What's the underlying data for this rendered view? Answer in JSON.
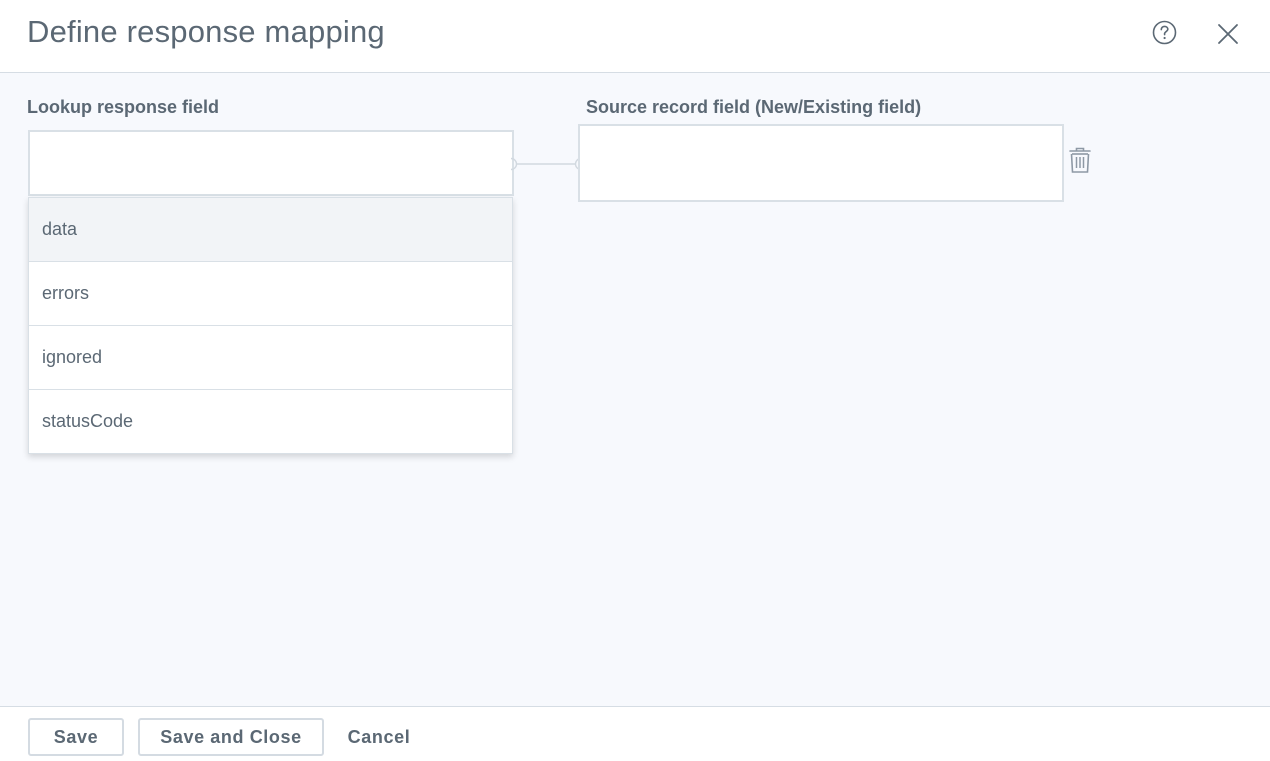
{
  "dialog": {
    "title": "Define response mapping"
  },
  "columns": {
    "lookup_label": "Lookup response field",
    "source_label": "Source record field (New/Existing field)"
  },
  "lookup_field": {
    "value": "",
    "placeholder": ""
  },
  "source_field": {
    "value": "",
    "placeholder": ""
  },
  "dropdown": {
    "options": [
      {
        "label": "data",
        "highlighted": true
      },
      {
        "label": "errors",
        "highlighted": false
      },
      {
        "label": "ignored",
        "highlighted": false
      },
      {
        "label": "statusCode",
        "highlighted": false
      }
    ]
  },
  "footer": {
    "save_label": "Save",
    "save_close_label": "Save and Close",
    "cancel_label": "Cancel"
  },
  "icons": {
    "help": "help-circle-icon",
    "close": "close-icon",
    "delete": "trash-icon"
  },
  "colors": {
    "content_bg": "#f7f9fd",
    "border": "#d9e0e6",
    "text": "#5b6874",
    "highlight_row": "#f2f4f7"
  }
}
